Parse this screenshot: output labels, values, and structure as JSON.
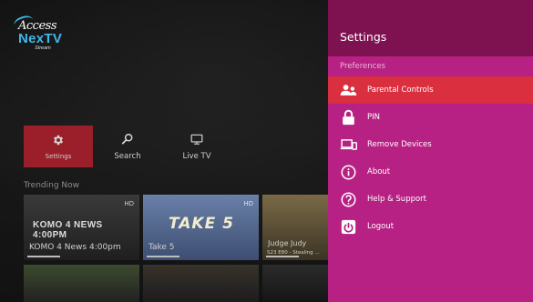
{
  "logo": {
    "top": "Access",
    "main": "NexTV",
    "sub": "Stream"
  },
  "nav": [
    {
      "label": "Settings",
      "icon": "gear-icon",
      "active": true
    },
    {
      "label": "Search",
      "icon": "search-icon",
      "active": false
    },
    {
      "label": "Live TV",
      "icon": "tv-icon",
      "active": false
    }
  ],
  "trending": {
    "title": "Trending Now",
    "tiles": [
      {
        "art": "KOMO 4 NEWS 4:00PM",
        "caption": "KOMO 4 News 4:00pm",
        "badge": "HD"
      },
      {
        "art": "TAKE 5",
        "caption": "Take 5",
        "badge": "HD"
      },
      {
        "caption": "Judge Judy",
        "sub": "S23 E80 - Stealing ..."
      }
    ]
  },
  "settings": {
    "title": "Settings",
    "section": "Preferences",
    "items": [
      {
        "label": "Parental Controls",
        "icon": "parental-controls-icon",
        "selected": true
      },
      {
        "label": "PIN",
        "icon": "lock-icon",
        "selected": false
      },
      {
        "label": "Remove Devices",
        "icon": "devices-icon",
        "selected": false
      },
      {
        "label": "About",
        "icon": "info-icon",
        "selected": false
      },
      {
        "label": "Help & Support",
        "icon": "help-icon",
        "selected": false
      },
      {
        "label": "Logout",
        "icon": "logout-icon",
        "selected": false
      }
    ]
  },
  "colors": {
    "accent": "#d92f3f",
    "panel": "#b72183",
    "panel_header": "#7e1250",
    "nav_active": "#9a1f2a"
  }
}
